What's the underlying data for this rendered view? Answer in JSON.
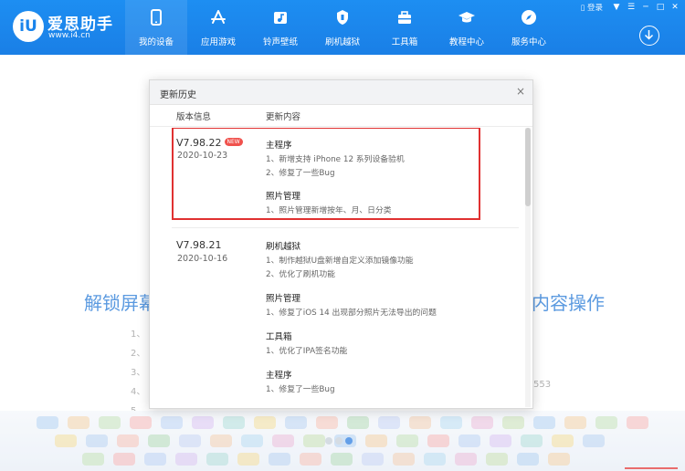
{
  "app": {
    "logo_text": "iU",
    "name": "爱思助手",
    "url": "www.i4.cn"
  },
  "nav": [
    {
      "label": "我的设备",
      "icon": "phone-icon",
      "active": true
    },
    {
      "label": "应用游戏",
      "icon": "app-store-icon",
      "active": false
    },
    {
      "label": "铃声壁纸",
      "icon": "music-icon",
      "active": false
    },
    {
      "label": "刷机越狱",
      "icon": "shield-icon",
      "active": false
    },
    {
      "label": "工具箱",
      "icon": "toolbox-icon",
      "active": false
    },
    {
      "label": "教程中心",
      "icon": "graduation-cap-icon",
      "active": false
    },
    {
      "label": "服务中心",
      "icon": "compass-icon",
      "active": false
    }
  ],
  "window": {
    "login": "登录",
    "icons": [
      "shirt-icon",
      "menu-icon",
      "minimize-icon",
      "maximize-icon",
      "close-icon"
    ]
  },
  "background": {
    "title_left": "解锁屏幕",
    "title_right": "内容操作",
    "list": [
      "1、",
      "2、",
      "3、",
      "4、",
      "5、"
    ],
    "number_text": "553"
  },
  "dialog": {
    "title": "更新历史",
    "close": "×",
    "col_version": "版本信息",
    "col_content": "更新内容",
    "new_badge": "NEW",
    "entries": [
      {
        "version": "V7.98.22",
        "date": "2020-10-23",
        "sections": [
          {
            "title": "主程序",
            "lines": [
              "1、新增支持 iPhone 12 系列设备验机",
              "2、修复了一些Bug"
            ]
          },
          {
            "title": "照片管理",
            "lines": [
              "1、照片管理新增按年、月、日分类"
            ]
          }
        ]
      },
      {
        "version": "V7.98.21",
        "date": "2020-10-16",
        "sections": [
          {
            "title": "刷机越狱",
            "lines": [
              "1、制作越狱U盘新增自定义添加镜像功能",
              "2、优化了刷机功能"
            ]
          },
          {
            "title": "照片管理",
            "lines": [
              "1、修复了iOS 14 出现部分照片无法导出的问题"
            ]
          },
          {
            "title": "工具箱",
            "lines": [
              "1、优化了IPA签名功能"
            ]
          },
          {
            "title": "主程序",
            "lines": [
              "1、修复了一些Bug"
            ]
          }
        ]
      }
    ]
  },
  "colors": {
    "brand_blue": "#1a84ec",
    "highlight_red": "#e03131",
    "new_badge": "#f0524d"
  }
}
